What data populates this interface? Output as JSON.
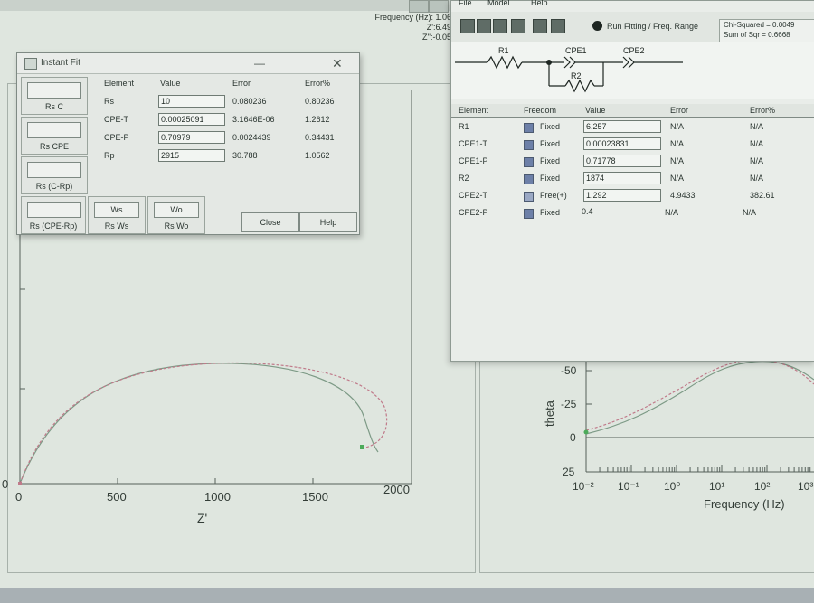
{
  "readout": {
    "frequency": "Frequency (Hz): 1.063",
    "zprime": "Z':6.495",
    "zdouble": "Z'':-0.051"
  },
  "instant_fit": {
    "title": "Instant Fit",
    "element_buttons": [
      {
        "label": "Rs C"
      },
      {
        "label": "Rs CPE"
      },
      {
        "label": "Rs (C-Rp)"
      },
      {
        "label": "Rs (CPE-Rp)"
      },
      {
        "label": "Rs Ws",
        "symbol": "Ws"
      },
      {
        "label": "Rs Wo",
        "symbol": "Wo"
      }
    ],
    "headers": [
      "Element",
      "Value",
      "Error",
      "Error%"
    ],
    "rows": [
      {
        "element": "Rs",
        "value": "10",
        "error": "0.080236",
        "error_pct": "0.80236"
      },
      {
        "element": "CPE-T",
        "value": "0.00025091",
        "error": "3.1646E-06",
        "error_pct": "1.2612"
      },
      {
        "element": "CPE-P",
        "value": "0.70979",
        "error": "0.0024439",
        "error_pct": "0.34431"
      },
      {
        "element": "Rp",
        "value": "2915",
        "error": "30.788",
        "error_pct": "1.0562"
      }
    ],
    "close_label": "Close",
    "help_label": "Help"
  },
  "fit_window": {
    "menu": [
      "File",
      "Model",
      "Help"
    ],
    "run_label": "Run Fitting / Freq. Range",
    "chi_squared": "Chi-Squared = 0.0049",
    "sum_sqr": "Sum of Sqr = 0.6668",
    "circuit": {
      "r1": "R1",
      "cpe1": "CPE1",
      "r2": "R2",
      "cpe2": "CPE2"
    },
    "headers": [
      "Element",
      "Freedom",
      "Value",
      "Error",
      "Error%"
    ],
    "rows": [
      {
        "element": "R1",
        "freedom": "Fixed",
        "value": "6.257",
        "error": "N/A",
        "error_pct": "N/A"
      },
      {
        "element": "CPE1-T",
        "freedom": "Fixed",
        "value": "0.00023831",
        "error": "N/A",
        "error_pct": "N/A"
      },
      {
        "element": "CPE1-P",
        "freedom": "Fixed",
        "value": "0.71778",
        "error": "N/A",
        "error_pct": "N/A"
      },
      {
        "element": "R2",
        "freedom": "Fixed",
        "value": "1874",
        "error": "N/A",
        "error_pct": "N/A"
      },
      {
        "element": "CPE2-T",
        "freedom": "Free(+)",
        "value": "1.292",
        "error": "4.9433",
        "error_pct": "382.61"
      },
      {
        "element": "CPE2-P",
        "freedom": "Fixed",
        "value": "0.4",
        "error": "N/A",
        "error_pct": "N/A"
      }
    ]
  },
  "nyquist": {
    "xlabel": "Z'",
    "xticks": [
      "0",
      "500",
      "1000",
      "1500",
      "2000"
    ],
    "ytick_partial": "0"
  },
  "bode": {
    "ylabel": "theta",
    "xlabel": "Frequency (Hz)",
    "yticks": [
      "-50",
      "-25",
      "0",
      "25"
    ],
    "xticks": [
      "10⁻²",
      "10⁻¹",
      "10⁰",
      "10¹",
      "10²",
      "10³"
    ]
  },
  "colors": {
    "fit_line": "#7d9a86",
    "data_line": "#c07a8a",
    "data_marker": "#4caa5a"
  }
}
